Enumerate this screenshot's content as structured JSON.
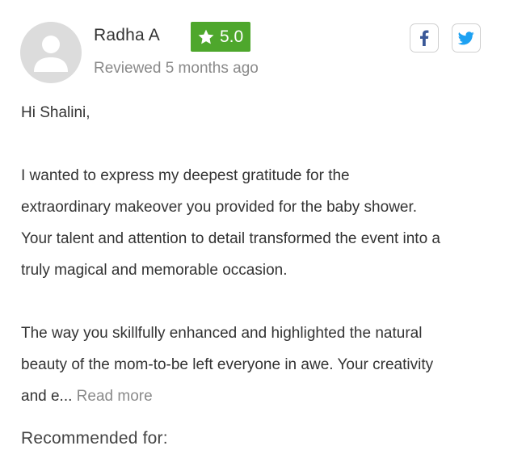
{
  "reviewer": {
    "name": "Radha A",
    "rating": "5.0",
    "reviewed_time": "Reviewed 5 months ago"
  },
  "colors": {
    "rating_badge": "#4ea72c",
    "facebook": "#3b5998",
    "twitter": "#1da1f2",
    "text": "#333333",
    "muted": "#8a8a8a"
  },
  "share": {
    "facebook_icon": "facebook-icon",
    "twitter_icon": "twitter-icon"
  },
  "review": {
    "greeting": "Hi Shalini,",
    "paragraph_1_line_1": "I wanted to express my deepest gratitude for the",
    "paragraph_1_line_2": "extraordinary makeover you provided for the baby shower.",
    "paragraph_1_line_3": "Your talent and attention to detail transformed the event into a",
    "paragraph_1_line_4": "truly magical and memorable occasion.",
    "paragraph_2_line_1": "The way you skillfully enhanced and highlighted the natural",
    "paragraph_2_line_2": "beauty of the mom-to-be left everyone in awe. Your creativity",
    "paragraph_2_line_3": "and e...",
    "read_more_label": "Read more"
  },
  "recommended_heading": "Recommended for:"
}
